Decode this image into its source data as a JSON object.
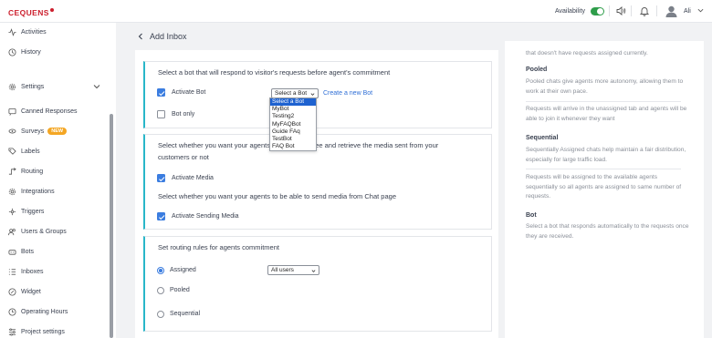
{
  "brand": {
    "name": "CEQUENS"
  },
  "topbar": {
    "availability_label": "Availability",
    "availability_on": true,
    "user_name": "Ali"
  },
  "sidebar": {
    "items": [
      {
        "label": "Activities",
        "icon": "activity-icon"
      },
      {
        "label": "History",
        "icon": "history-icon"
      },
      {
        "label": "Settings",
        "icon": "gear-icon"
      },
      {
        "label": "Canned Responses",
        "icon": "canned-responses-icon"
      },
      {
        "label": "Surveys",
        "icon": "surveys-icon",
        "badge": "NEW"
      },
      {
        "label": "Labels",
        "icon": "label-icon"
      },
      {
        "label": "Routing",
        "icon": "routing-icon"
      },
      {
        "label": "Integrations",
        "icon": "integrations-icon"
      },
      {
        "label": "Triggers",
        "icon": "triggers-icon"
      },
      {
        "label": "Users & Groups",
        "icon": "users-groups-icon"
      },
      {
        "label": "Bots",
        "icon": "bot-icon"
      },
      {
        "label": "Inboxes",
        "icon": "inboxes-icon"
      },
      {
        "label": "Widget",
        "icon": "widget-icon"
      },
      {
        "label": "Operating Hours",
        "icon": "clock-icon"
      },
      {
        "label": "Project settings",
        "icon": "project-settings-icon"
      }
    ]
  },
  "main": {
    "title": "Add Inbox",
    "bot_section": {
      "description": "Select a bot that will respond to visitor's requests before agent's commitment",
      "activate_bot_label": "Activate Bot",
      "activate_bot_checked": true,
      "bot_only_label": "Bot only",
      "bot_only_checked": false,
      "bot_select_value": "Select a Bot",
      "create_bot_link": "Create a new Bot",
      "bot_options": [
        "Select a Bot",
        "MyBot",
        "Testing2",
        "MyFAQBot",
        "Guide FAq",
        "TestBot",
        "FAQ Bot"
      ]
    },
    "media_section": {
      "description_line1": "Select whether you want your agents to be able to see and retrieve the media sent from your",
      "description_line2": "customers or not",
      "activate_media_label": "Activate Media",
      "send_description": "Select whether you want your agents to be able to send media from Chat page",
      "activate_sending_label": "Activate Sending Media"
    },
    "routing_section": {
      "description": "Set routing rules for agents commitment",
      "options": [
        "Assigned",
        "Pooled",
        "Sequential"
      ],
      "selected": "Assigned",
      "users_select_value": "All users"
    }
  },
  "help_panel": {
    "intro_tail": "that doesn't have requests assigned currently.",
    "pooled_title": "Pooled",
    "pooled_text": "Pooled chats give agents more autonomy, allowing them to work at their own pace.",
    "pooled_text2": "Requests will arrive in the unassigned tab and agents will be able to join it whenever they want",
    "sequential_title": "Sequential",
    "sequential_text": "Sequentially Assigned chats help maintain a fair distribution, especially for large traffic load.",
    "sequential_text2": "Requests will be assigned to the available agents sequentially so all agents are assigned to same number of requests.",
    "bot_title": "Bot",
    "bot_text": "Select a bot that responds automatically to the requests once they are received."
  },
  "colors": {
    "brand_red": "#cc1f2d",
    "accent_blue": "#3b7de0",
    "card_accent": "#29b6c9",
    "toggle_green": "#2e9d4a",
    "badge_orange": "#f4a623"
  }
}
